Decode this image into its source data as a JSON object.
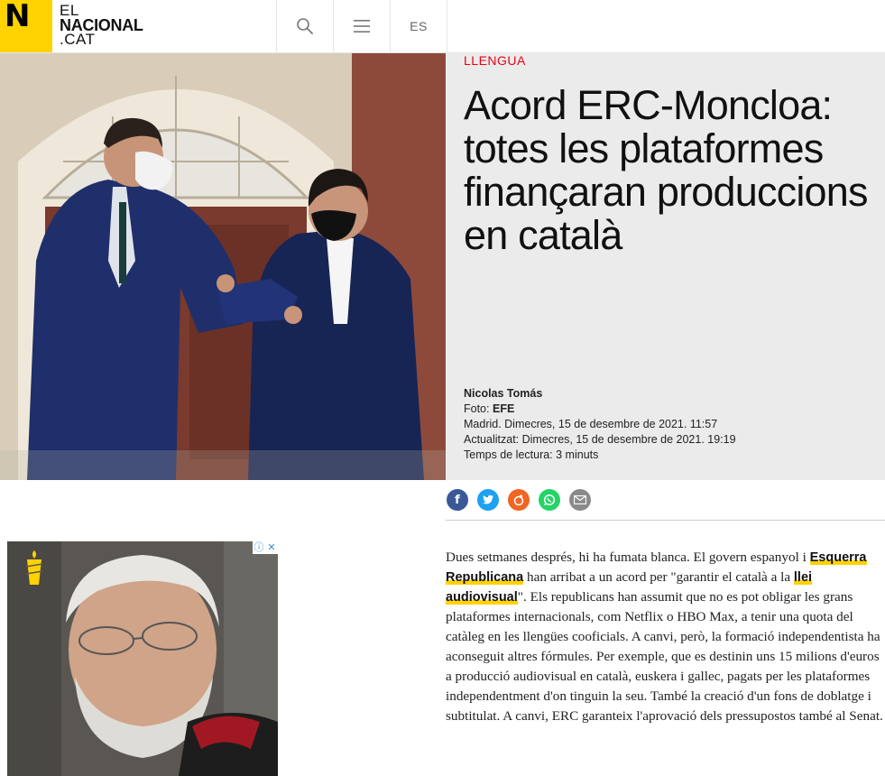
{
  "header": {
    "logo_mark": "N",
    "logo_line1": "EL",
    "logo_line2": "NACIONAL",
    "logo_line3": ".CAT",
    "search_icon": "search-icon",
    "menu_icon": "hamburger-menu-icon",
    "language_label": "ES"
  },
  "article": {
    "kicker": "LLENGUA",
    "headline": "Acord ERC-Moncloa: totes les plataformes finançaran produccions en català",
    "author": "Nicolas Tomás",
    "photo_label": "Foto:",
    "photo_credit": "EFE",
    "published": "Madrid. Dimecres, 15 de desembre de 2021. 11:57",
    "updated": "Actualitzat: Dimecres, 15 de desembre de 2021. 19:19",
    "reading_time": "Temps de lectura: 3 minuts",
    "body": {
      "t1": "Dues setmanes després, hi ha fumata blanca. El govern espanyol i ",
      "link1": "Esquerra Republicana",
      "t2": " han arribat a un acord per \"garantir el català a la ",
      "link2": "llei audiovisual",
      "t3": "\". Els republicans han assumit que no es pot obligar les grans plataformes internacionals, com Netflix o HBO Max, a tenir una quota del catàleg en les llengües cooficials. A canvi, però, la formació independentista ha aconseguit altres fórmules. Per exemple, que es destinin uns 15 milions d'euros a producció audiovisual en català, euskera i gallec, pagats per les plataformes independentment d'on tinguin la seu. També la creació d'un fons de doblatge i subtitulat. A canvi, ERC garanteix l'aprovació dels pressupostos també al Senat."
    }
  },
  "share": [
    {
      "name": "facebook-icon",
      "color": "#3b5998",
      "glyph": "f"
    },
    {
      "name": "twitter-icon",
      "color": "#1da1f2",
      "glyph": "t"
    },
    {
      "name": "meneame-icon",
      "color": "#f26522",
      "glyph": "m"
    },
    {
      "name": "whatsapp-icon",
      "color": "#25d366",
      "glyph": "w"
    },
    {
      "name": "email-icon",
      "color": "#8a8a8a",
      "glyph": "✉"
    }
  ],
  "ad": {
    "info_icon": "ⓘ",
    "close_icon": "✕"
  },
  "colors": {
    "brand_yellow": "#ffd200",
    "kicker_red": "#e30613",
    "panel_gray": "#ebebeb"
  }
}
